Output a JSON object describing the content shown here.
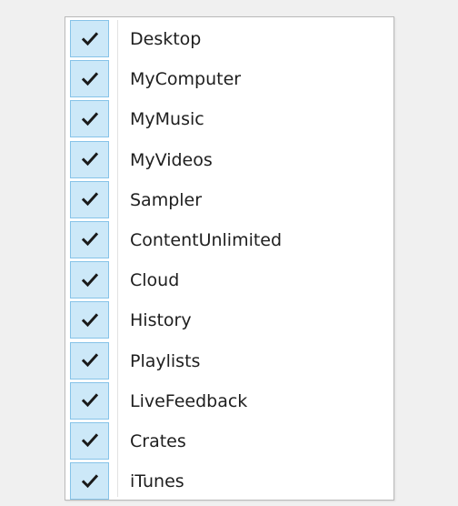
{
  "menu": {
    "items": [
      {
        "label": "Desktop",
        "checked": true
      },
      {
        "label": "MyComputer",
        "checked": true
      },
      {
        "label": "MyMusic",
        "checked": true
      },
      {
        "label": "MyVideos",
        "checked": true
      },
      {
        "label": "Sampler",
        "checked": true
      },
      {
        "label": "ContentUnlimited",
        "checked": true
      },
      {
        "label": "Cloud",
        "checked": true
      },
      {
        "label": "History",
        "checked": true
      },
      {
        "label": "Playlists",
        "checked": true
      },
      {
        "label": "LiveFeedback",
        "checked": true
      },
      {
        "label": "Crates",
        "checked": true
      },
      {
        "label": "iTunes",
        "checked": true
      }
    ]
  },
  "colors": {
    "check_bg": "#cce8f8",
    "check_border": "#86c3e8",
    "check_mark": "#1a1a1a",
    "text": "#1e1e1e"
  },
  "icons": {
    "check": "checkmark-icon"
  }
}
